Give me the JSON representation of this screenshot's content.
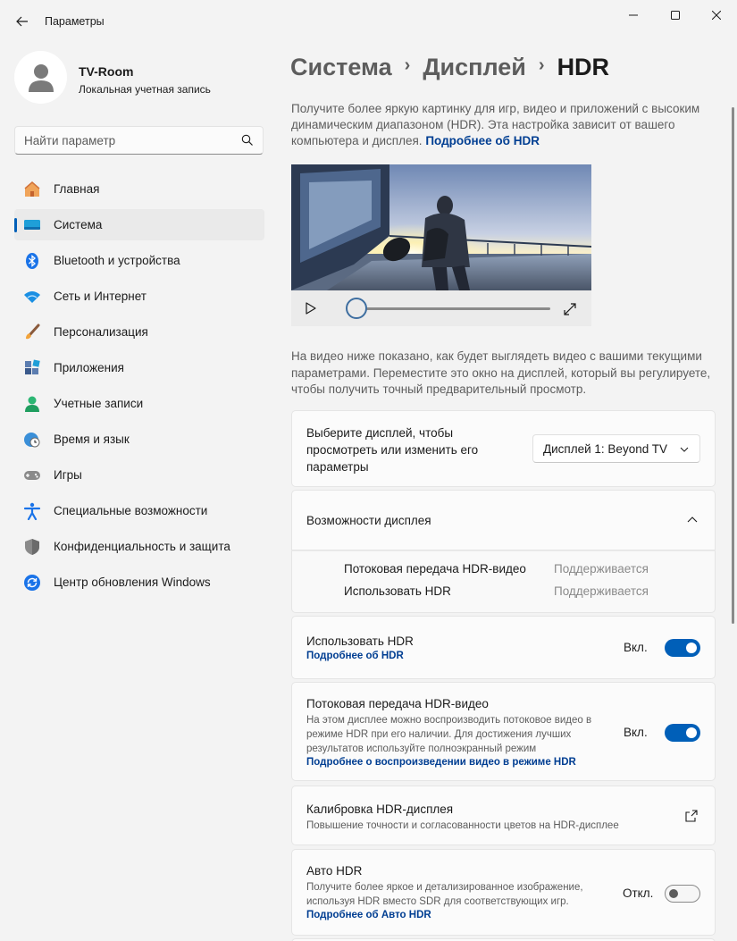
{
  "window": {
    "title": "Параметры",
    "controls": {
      "minimize": "minimize-icon",
      "maximize": "maximize-icon",
      "close": "close-icon"
    }
  },
  "profile": {
    "name": "TV-Room",
    "account_type": "Локальная учетная запись"
  },
  "search": {
    "placeholder": "Найти параметр"
  },
  "nav": {
    "items": [
      {
        "label": "Главная",
        "icon": "home-icon"
      },
      {
        "label": "Система",
        "icon": "system-icon",
        "active": true
      },
      {
        "label": "Bluetooth и устройства",
        "icon": "bluetooth-icon"
      },
      {
        "label": "Сеть и Интернет",
        "icon": "wifi-icon"
      },
      {
        "label": "Персонализация",
        "icon": "brush-icon"
      },
      {
        "label": "Приложения",
        "icon": "apps-icon"
      },
      {
        "label": "Учетные записи",
        "icon": "accounts-icon"
      },
      {
        "label": "Время и язык",
        "icon": "time-language-icon"
      },
      {
        "label": "Игры",
        "icon": "gamepad-icon"
      },
      {
        "label": "Специальные возможности",
        "icon": "accessibility-icon"
      },
      {
        "label": "Конфиденциальность и защита",
        "icon": "shield-icon"
      },
      {
        "label": "Центр обновления Windows",
        "icon": "update-icon"
      }
    ]
  },
  "breadcrumb": {
    "parent1": "Система",
    "parent2": "Дисплей",
    "current": "HDR",
    "separator": "›"
  },
  "intro": {
    "text": "Получите более яркую картинку для игр, видео и приложений с высоким динамическим диапазоном (HDR). Эта настройка зависит от вашего компьютера и дисплея.",
    "link": "Подробнее об HDR"
  },
  "video_preview": {
    "progress": 0
  },
  "preview_note": "На видео ниже показано, как будет выглядеть видео с вашими текущими параметрами. Переместите это окно на дисплей, который вы регулируете, чтобы получить точный предварительный просмотр.",
  "display_select": {
    "label": "Выберите дисплей, чтобы просмотреть или изменить его параметры",
    "value": "Дисплей 1: Beyond TV"
  },
  "capabilities": {
    "title": "Возможности дисплея",
    "rows": [
      {
        "name": "Потоковая передача HDR-видео",
        "value": "Поддерживается"
      },
      {
        "name": "Использовать HDR",
        "value": "Поддерживается"
      }
    ]
  },
  "use_hdr": {
    "title": "Использовать HDR",
    "link": "Подробнее об HDR",
    "state": "Вкл.",
    "on": true
  },
  "hdr_video": {
    "title": "Потоковая передача HDR-видео",
    "description": "На этом дисплее можно воспроизводить потоковое видео в режиме HDR при его наличии. Для достижения лучших результатов используйте полноэкранный режим",
    "link": "Подробнее о воспроизведении видео в режиме HDR",
    "state": "Вкл.",
    "on": true
  },
  "calibration": {
    "title": "Калибровка HDR-дисплея",
    "description": "Повышение точности и согласованности цветов на HDR-дисплее"
  },
  "auto_hdr": {
    "title": "Авто HDR",
    "description": "Получите более яркое и детализированное изображение, используя HDR вместо SDR для соответствующих игр.",
    "link": "Подробнее об Авто HDR",
    "state": "Откл.",
    "on": false
  },
  "colors": {
    "accent": "#005fb8",
    "link": "#003e92",
    "background": "#f3f3f3",
    "card": "#fbfbfb"
  }
}
